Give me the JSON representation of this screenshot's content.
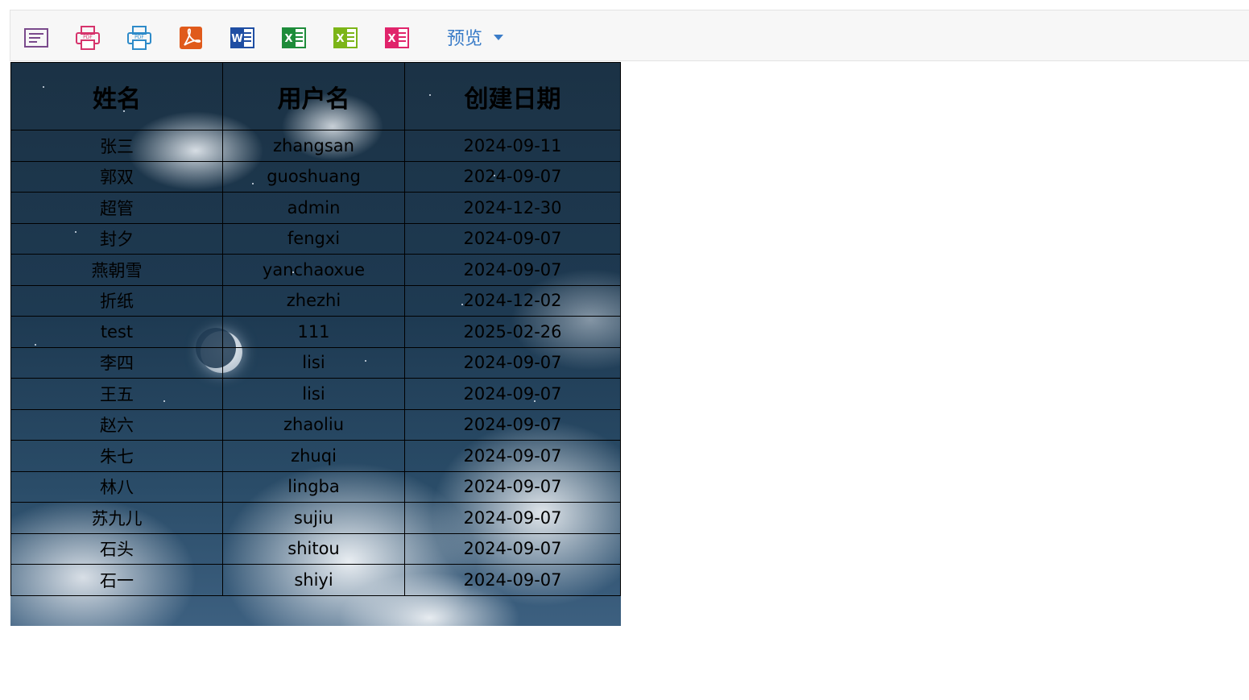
{
  "toolbar": {
    "icons": [
      {
        "name": "print-preview-icon",
        "color": "#7a4a8c"
      },
      {
        "name": "pdf-print-icon",
        "color": "#d6336c"
      },
      {
        "name": "pdf-print-icon",
        "color": "#2e8bc9"
      },
      {
        "name": "pdf-export-icon",
        "color": "#e05a1b"
      },
      {
        "name": "word-export-icon",
        "color": "#1f4ea3"
      },
      {
        "name": "excel-export-icon",
        "color": "#1e8c3a"
      },
      {
        "name": "excel-export-icon",
        "color": "#7cb518"
      },
      {
        "name": "excel-export-icon",
        "color": "#e0246b"
      }
    ],
    "preview_label": "预览",
    "accent": "#3a7cc8"
  },
  "table": {
    "headers": [
      "姓名",
      "用户名",
      "创建日期"
    ],
    "rows": [
      [
        "张三",
        "zhangsan",
        "2024-09-11"
      ],
      [
        "郭双",
        "guoshuang",
        "2024-09-07"
      ],
      [
        "超管",
        "admin",
        "2024-12-30"
      ],
      [
        "封夕",
        "fengxi",
        "2024-09-07"
      ],
      [
        "燕朝雪",
        "yanchaoxue",
        "2024-09-07"
      ],
      [
        "折纸",
        "zhezhi",
        "2024-12-02"
      ],
      [
        "test",
        "111",
        "2025-02-26"
      ],
      [
        "李四",
        "lisi",
        "2024-09-07"
      ],
      [
        "王五",
        "lisi",
        "2024-09-07"
      ],
      [
        "赵六",
        "zhaoliu",
        "2024-09-07"
      ],
      [
        "朱七",
        "zhuqi",
        "2024-09-07"
      ],
      [
        "林八",
        "lingba",
        "2024-09-07"
      ],
      [
        "苏九儿",
        "sujiu",
        "2024-09-07"
      ],
      [
        "石头",
        "shitou",
        "2024-09-07"
      ],
      [
        "石一",
        "shiyi",
        "2024-09-07"
      ]
    ]
  }
}
